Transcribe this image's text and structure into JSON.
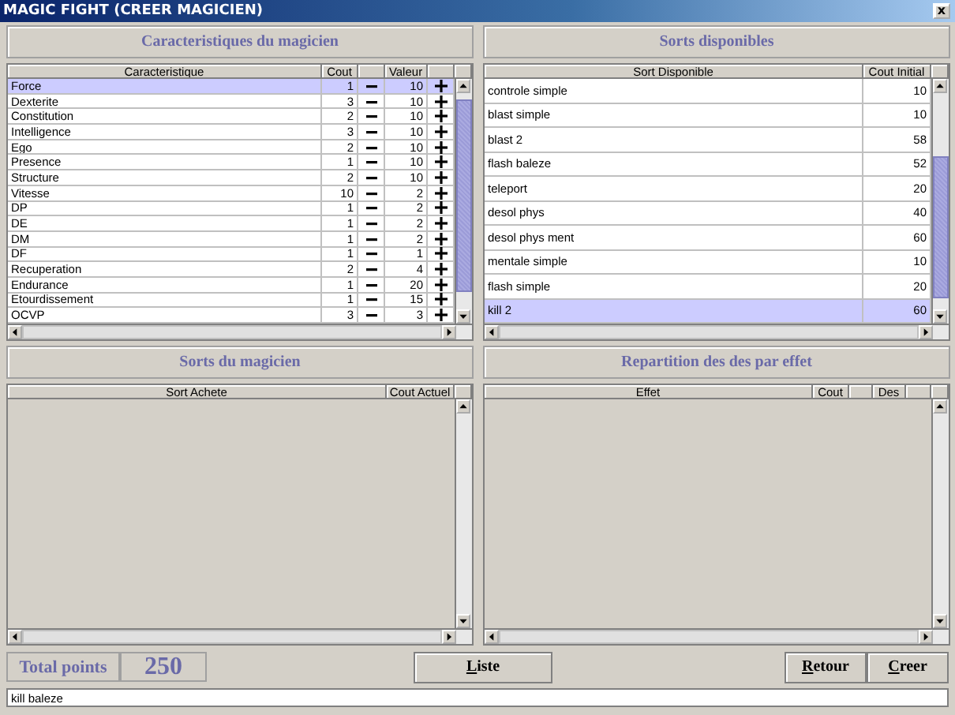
{
  "window": {
    "title": "MAGIC FIGHT (CREER MAGICIEN)",
    "close": "x"
  },
  "characteristics": {
    "title": "Caracteristiques du magicien",
    "columns": [
      "Caracteristique",
      "Cout",
      "Valeur"
    ],
    "rows": [
      {
        "name": "Force",
        "cout": "1",
        "valeur": "10",
        "selected": true
      },
      {
        "name": "Dexterite",
        "cout": "3",
        "valeur": "10",
        "selected": false
      },
      {
        "name": "Constitution",
        "cout": "2",
        "valeur": "10",
        "selected": false
      },
      {
        "name": "Intelligence",
        "cout": "3",
        "valeur": "10",
        "selected": false
      },
      {
        "name": "Ego",
        "cout": "2",
        "valeur": "10",
        "selected": false
      },
      {
        "name": "Presence",
        "cout": "1",
        "valeur": "10",
        "selected": false
      },
      {
        "name": "Structure",
        "cout": "2",
        "valeur": "10",
        "selected": false
      },
      {
        "name": "Vitesse",
        "cout": "10",
        "valeur": "2",
        "selected": false
      },
      {
        "name": "DP",
        "cout": "1",
        "valeur": "2",
        "selected": false
      },
      {
        "name": "DE",
        "cout": "1",
        "valeur": "2",
        "selected": false
      },
      {
        "name": "DM",
        "cout": "1",
        "valeur": "2",
        "selected": false
      },
      {
        "name": "DF",
        "cout": "1",
        "valeur": "1",
        "selected": false
      },
      {
        "name": "Recuperation",
        "cout": "2",
        "valeur": "4",
        "selected": false
      },
      {
        "name": "Endurance",
        "cout": "1",
        "valeur": "20",
        "selected": false
      },
      {
        "name": "Etourdissement",
        "cout": "1",
        "valeur": "15",
        "selected": false
      },
      {
        "name": "OCVP",
        "cout": "3",
        "valeur": "3",
        "selected": false
      }
    ]
  },
  "available_spells": {
    "title": "Sorts disponibles",
    "columns": [
      "Sort Disponible",
      "Cout Initial"
    ],
    "rows": [
      {
        "name": "controle simple",
        "cout": "10",
        "selected": false
      },
      {
        "name": "blast simple",
        "cout": "10",
        "selected": false
      },
      {
        "name": "blast 2",
        "cout": "58",
        "selected": false
      },
      {
        "name": "flash baleze",
        "cout": "52",
        "selected": false
      },
      {
        "name": "teleport",
        "cout": "20",
        "selected": false
      },
      {
        "name": "desol phys",
        "cout": "40",
        "selected": false
      },
      {
        "name": "desol phys ment",
        "cout": "60",
        "selected": false
      },
      {
        "name": "mentale simple",
        "cout": "10",
        "selected": false
      },
      {
        "name": "flash simple",
        "cout": "20",
        "selected": false
      },
      {
        "name": "kill 2",
        "cout": "60",
        "selected": true
      }
    ]
  },
  "wizard_spells": {
    "title": "Sorts du magicien",
    "columns": [
      "Sort Achete",
      "Cout Actuel"
    ]
  },
  "dice_distribution": {
    "title": "Repartition des des par effet",
    "columns": [
      "Effet",
      "Cout",
      "Des"
    ]
  },
  "total": {
    "label": "Total points",
    "value": "250"
  },
  "buttons": [
    "Liste",
    "Retour",
    "Creer"
  ],
  "input": {
    "value": "kill baleze"
  }
}
